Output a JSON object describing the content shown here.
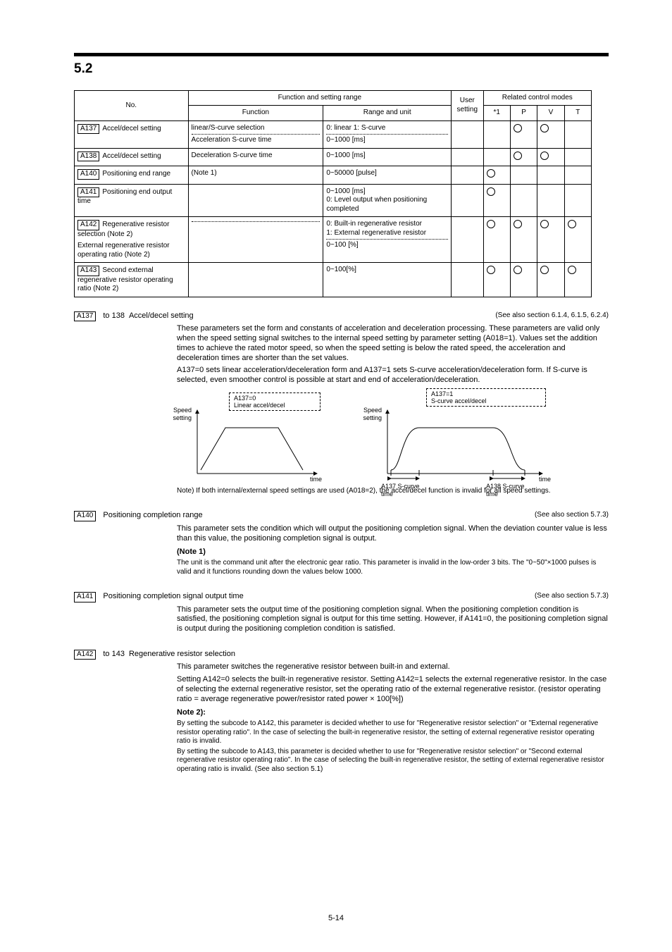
{
  "section_number": "5.2",
  "table": {
    "headers": {
      "no": "No.",
      "func_range": "Function and setting range",
      "func": "Function",
      "range": "Range and unit",
      "user": "User setting",
      "control_modes": "Related control modes"
    },
    "mode_labels": [
      "P",
      "V",
      "T"
    ],
    "rows": [
      {
        "no": "A137",
        "label": "Accel/decel setting",
        "func_top": "linear/S-curve selection",
        "range_top": "0: linear  1: S-curve",
        "func_bot": "Acceleration S-curve time",
        "range_bot": "0~1000 [ms]",
        "user": "",
        "modes": [
          "",
          "○",
          "○",
          ""
        ],
        "dotted": true
      },
      {
        "no": "A138",
        "label": "Accel/decel setting",
        "func_top": "Deceleration S-curve time",
        "range_top": "0~1000 [ms]",
        "user": "",
        "modes": [
          "",
          "○",
          "○",
          ""
        ],
        "dotted": false
      },
      {
        "no": "A140",
        "label": "Positioning end range",
        "func_top": "(Note 1)",
        "range_top": "0~50000 [pulse]",
        "user": "",
        "modes": [
          "○",
          "",
          "",
          ""
        ],
        "dotted": false
      },
      {
        "no": "A141",
        "label": "Positioning end output time",
        "func_top": "",
        "range_top": "0~1000 [ms]\n0: Level output when positioning completed",
        "user": "",
        "modes": [
          "○",
          "",
          "",
          ""
        ],
        "dotted": false
      },
      {
        "no": "A142",
        "label_top": "Regenerative resistor selection (Note 2)",
        "label_bot": "External regenerative resistor operating ratio (Note 2)",
        "func_top": "",
        "range_top_top": "0: Built-in regenerative resistor\n1: External regenerative resistor",
        "range_top_bot": "0~100 [%]",
        "user": "",
        "modes": [
          "○",
          "○",
          "○",
          "○"
        ],
        "dotted": true,
        "combined": true
      },
      {
        "no": "A143",
        "label": "Second external regenerative resistor operating ratio (Note 2)",
        "func_top": "",
        "range_top": "0~100[%]",
        "user": "",
        "modes": [
          "○",
          "○",
          "○",
          "○"
        ],
        "dotted": false
      }
    ]
  },
  "descriptions": [
    {
      "num": "A137",
      "title_row": [
        "Accel/decel setting",
        "",
        "",
        "(See also section 6.1.4, 6.1.5, 6.2.4)"
      ],
      "boxed_num": "A137",
      "heading_cont": "to 138",
      "paras": [
        "These parameters set the form and constants of acceleration and deceleration processing. These parameters are valid only when the speed setting signal switches to the internal speed setting by parameter setting (A018=1). Values set the addition times to achieve the rated motor speed, so when the speed setting is below the rated speed, the acceleration and deceleration times are shorter than the set values.",
        "A137=0 sets linear acceleration/deceleration form and A137=1 sets S-curve acceleration/deceleration form. If S-curve is selected, even smoother control is possible at start and end of acceleration/deceleration."
      ],
      "note": "Note) If both internal/external speed settings are used (A018=2), the accel/decel function is invalid for all speed settings.",
      "chart_data": [
        {
          "type": "line",
          "title": "A137=0\nLinear accel/decel",
          "xlabel": "time",
          "ylabel": "Speed setting",
          "shape": "trapezoid"
        },
        {
          "type": "line",
          "title": "A137=1\nS-curve accel/decel",
          "xlabel": "time",
          "ylabel": "Speed setting",
          "shape": "s-curve",
          "annotations": [
            "A137 S-curve time",
            "A138 S-curve time"
          ]
        }
      ]
    },
    {
      "num": "A140",
      "title_row": [
        "Positioning completion range",
        "",
        "",
        "(See also section 5.7.3)"
      ],
      "paras": [
        "This parameter sets the condition which will output the positioning completion signal. When the deviation counter value is less than this value, the positioning completion signal is output."
      ],
      "note_label": "(Note 1)",
      "note_paras": [
        "The unit is the command unit after the electronic gear ratio. This parameter is invalid in the low-order 3 bits. The \"0~50\"×1000 pulses is valid and it functions rounding down the values below 1000."
      ]
    },
    {
      "num": "A141",
      "title_row": [
        "Positioning completion signal output time",
        "",
        "",
        "(See also section 5.7.3)"
      ],
      "paras": [
        "This parameter sets the output time of the positioning completion signal. When the positioning completion condition is satisfied, the positioning completion signal is output for this time setting. However, if A141=0, the positioning completion signal is output during the positioning completion condition is satisfied."
      ]
    },
    {
      "num": "A142",
      "title_row": [
        "Regenerative resistor selection",
        "",
        "",
        ""
      ],
      "num_cont": "to 143",
      "paras": [
        "This parameter switches the regenerative resistor between built-in and external.",
        "Setting A142=0 selects the built-in regenerative resistor. Setting A142=1 selects the external regenerative resistor. In the case of selecting the external regenerative resistor, set the operating ratio of the external regenerative resistor. (resistor operating ratio = average regenerative power/resistor rated power × 100[%])"
      ],
      "note_label": "Note 2):",
      "note_paras": [
        "By setting the subcode to A142, this parameter is decided whether to use for \"Regenerative resistor selection\" or \"External regenerative resistor operating ratio\". In the case of selecting the built-in regenerative resistor, the setting of external regenerative resistor operating ratio is invalid.",
        "By setting the subcode to A143, this parameter is decided whether to use for \"Regenerative resistor selection\" or \"Second external regenerative resistor operating ratio\". In the case of selecting the built-in regenerative resistor, the setting of external regenerative resistor operating ratio is invalid. (See also section 5.1)"
      ]
    }
  ],
  "page_number": "5-14"
}
